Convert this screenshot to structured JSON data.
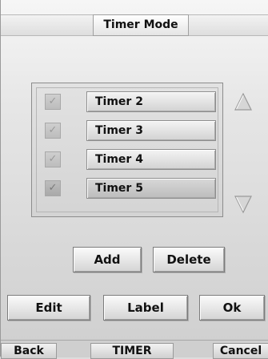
{
  "header": {
    "title": "Timer Mode"
  },
  "timer_list": {
    "items": [
      {
        "label": "Timer 2",
        "checked": true,
        "selected": false
      },
      {
        "label": "Timer 3",
        "checked": true,
        "selected": false
      },
      {
        "label": "Timer 4",
        "checked": true,
        "selected": false
      },
      {
        "label": "Timer 5",
        "checked": true,
        "selected": true
      }
    ],
    "check_glyph": "✓"
  },
  "actions": {
    "add_label": "Add",
    "delete_label": "Delete",
    "edit_label": "Edit",
    "label_label": "Label",
    "ok_label": "Ok"
  },
  "bottom_bar": {
    "back_label": "Back",
    "center_label": "TIMER",
    "cancel_label": "Cancel"
  },
  "icons": {
    "scroll_up": "triangle-up-icon",
    "scroll_down": "triangle-down-icon"
  }
}
